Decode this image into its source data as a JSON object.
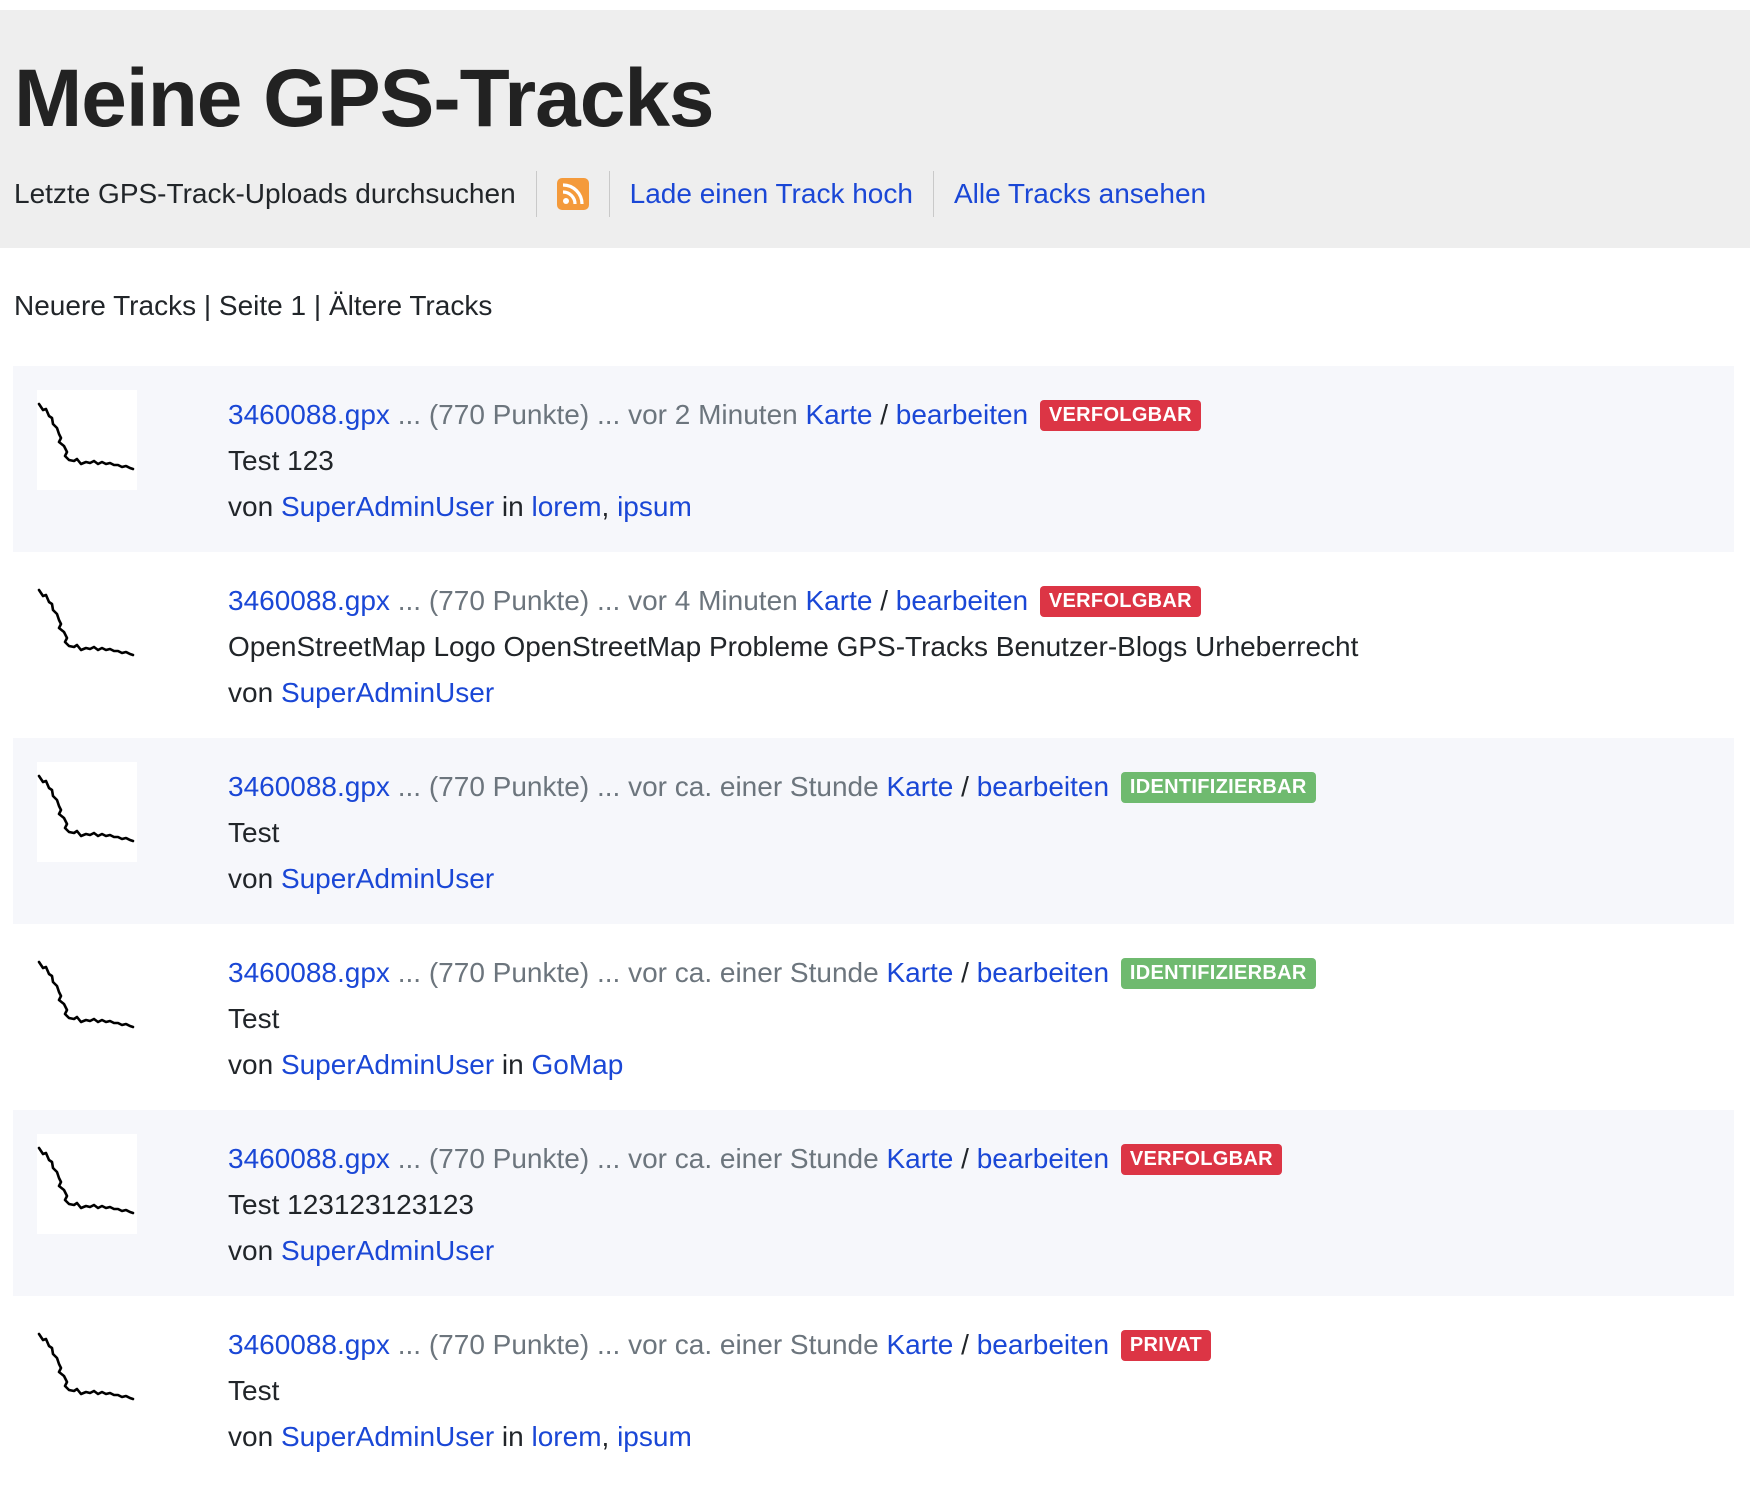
{
  "header": {
    "title": "Meine GPS-Tracks",
    "search_text": "Letzte GPS-Track-Uploads durchsuchen",
    "rss_icon": "rss-icon",
    "upload_link": "Lade einen Track hoch",
    "all_tracks_link": "Alle Tracks ansehen"
  },
  "pager": {
    "newer": "Neuere Tracks",
    "sep1": " | ",
    "page": "Seite 1",
    "sep2": " | ",
    "older": "Ältere Tracks"
  },
  "colors": {
    "header_bg": "#eeeeee",
    "link": "#1a47d6",
    "badge_red": "#dc3545",
    "badge_green": "#6fba6f",
    "row_alt": "#f6f7fb",
    "rss": "#f49a3b"
  },
  "common": {
    "sep_dots": " ... ",
    "slash": " / ",
    "edit": "bearbeiten",
    "map": "Karte",
    "by": "von ",
    "in": " in ",
    "comma": ", "
  },
  "tracks": [
    {
      "filename": "3460088.gpx",
      "points": "(770 Punkte)",
      "time": "vor 2 Minuten",
      "map": "Karte",
      "edit": "bearbeiten",
      "badge": "VERFOLGBAR",
      "description": "Test 123",
      "user": "SuperAdminUser",
      "tags": [
        "lorem",
        "ipsum"
      ]
    },
    {
      "filename": "3460088.gpx",
      "points": "(770 Punkte)",
      "time": "vor 4 Minuten",
      "map": "Karte",
      "edit": "bearbeiten",
      "badge": "VERFOLGBAR",
      "description": "OpenStreetMap Logo OpenStreetMap Probleme GPS-Tracks Benutzer-Blogs Urheberrecht",
      "user": "SuperAdminUser",
      "tags": []
    },
    {
      "filename": "3460088.gpx",
      "points": "(770 Punkte)",
      "time": "vor ca. einer Stunde",
      "map": "Karte",
      "edit": "bearbeiten",
      "badge": "IDENTIFIZIERBAR",
      "description": "Test",
      "user": "SuperAdminUser",
      "tags": []
    },
    {
      "filename": "3460088.gpx",
      "points": "(770 Punkte)",
      "time": "vor ca. einer Stunde",
      "map": "Karte",
      "edit": "bearbeiten",
      "badge": "IDENTIFIZIERBAR",
      "description": "Test",
      "user": "SuperAdminUser",
      "tags": [
        "GoMap"
      ]
    },
    {
      "filename": "3460088.gpx",
      "points": "(770 Punkte)",
      "time": "vor ca. einer Stunde",
      "map": "Karte",
      "edit": "bearbeiten",
      "badge": "VERFOLGBAR",
      "description": "Test 123123123123",
      "user": "SuperAdminUser",
      "tags": []
    },
    {
      "filename": "3460088.gpx",
      "points": "(770 Punkte)",
      "time": "vor ca. einer Stunde",
      "map": "Karte",
      "edit": "bearbeiten",
      "badge": "PRIVAT",
      "description": "Test",
      "user": "SuperAdminUser",
      "tags": [
        "lorem",
        "ipsum"
      ]
    }
  ]
}
